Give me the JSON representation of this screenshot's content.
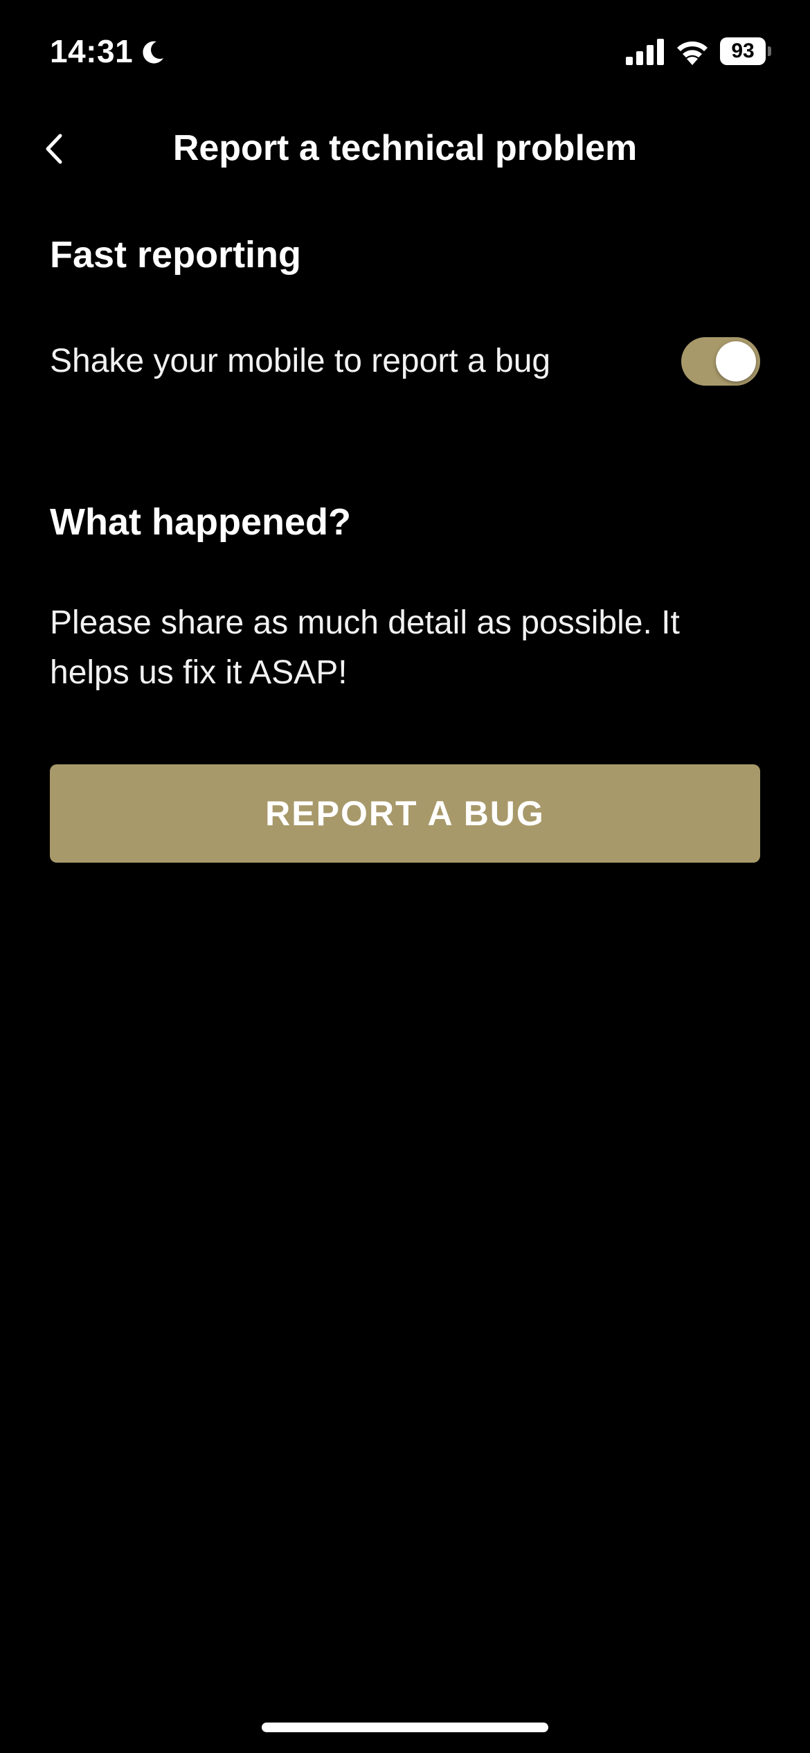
{
  "status_bar": {
    "time": "14:31",
    "battery_level": "93",
    "icons": [
      "moon-icon",
      "signal-icon",
      "wifi-icon",
      "battery-icon"
    ]
  },
  "header": {
    "title": "Report a technical problem",
    "back_icon": "chevron-left-icon"
  },
  "fast_reporting": {
    "title": "Fast reporting",
    "shake_label": "Shake your mobile to report a bug",
    "shake_enabled": true
  },
  "what_happened": {
    "title": "What happened?",
    "description": "Please share as much detail as possible. It helps us fix it ASAP!"
  },
  "actions": {
    "report_label": "REPORT A BUG"
  },
  "colors": {
    "background": "#000000",
    "accent": "#a8996b",
    "text": "#ffffff"
  }
}
